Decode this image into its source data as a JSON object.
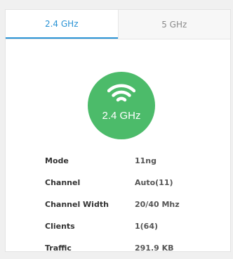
{
  "tabs": [
    {
      "label": "2.4 GHz",
      "active": true
    },
    {
      "label": "5 GHz",
      "active": false
    }
  ],
  "hero": {
    "icon": "wifi-icon",
    "label": "2.4 GHz",
    "color": "#4cbb6a"
  },
  "details": [
    {
      "key": "Mode",
      "value": "11ng"
    },
    {
      "key": "Channel",
      "value": "Auto(11)"
    },
    {
      "key": "Channel Width",
      "value": "20/40 Mhz"
    },
    {
      "key": "Clients",
      "value": "1(64)"
    },
    {
      "key": "Traffic",
      "value": "291.9 KB"
    }
  ],
  "colors": {
    "accent": "#2a93d5",
    "inactive_text": "#8a8a8a"
  }
}
